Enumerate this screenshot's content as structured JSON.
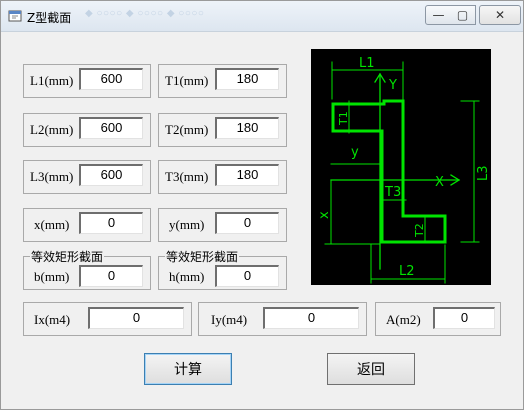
{
  "window": {
    "title": "Z型截面",
    "title_faint": "◆  ○○○○ ◆  ○○○○ ◆  ○○○○",
    "controls": {
      "minimize": "—",
      "maximize": "▢",
      "close": "✕"
    }
  },
  "inputs": {
    "L1": {
      "label": "L1(mm)",
      "value": "600"
    },
    "L2": {
      "label": "L2(mm)",
      "value": "600"
    },
    "L3": {
      "label": "L3(mm)",
      "value": "600"
    },
    "T1": {
      "label": "T1(mm)",
      "value": "180"
    },
    "T2": {
      "label": "T2(mm)",
      "value": "180"
    },
    "T3": {
      "label": "T3(mm)",
      "value": "180"
    },
    "x": {
      "label": "x(mm)",
      "value": "0"
    },
    "y": {
      "label": "y(mm)",
      "value": "0"
    }
  },
  "equivalent": {
    "left": {
      "title": "等效矩形截面",
      "label": "b(mm)",
      "value": "0"
    },
    "right": {
      "title": "等效矩形截面",
      "label": "h(mm)",
      "value": "0"
    }
  },
  "results": {
    "Ix": {
      "label": "Ix(m4)",
      "value": "0"
    },
    "Iy": {
      "label": "Iy(m4)",
      "value": "0"
    },
    "A": {
      "label": "A(m2)",
      "value": "0"
    }
  },
  "buttons": {
    "calculate": "计算",
    "back": "返回"
  },
  "diagram": {
    "labels": {
      "L1": "L1",
      "L2": "L2",
      "L3": "L3",
      "T1": "T1",
      "T2": "T2",
      "T3": "T3",
      "X": "X",
      "Y": "Y",
      "x": "x",
      "y": "y"
    }
  },
  "colors": {
    "diagram_line": "#00e400",
    "diagram_bg": "#000000",
    "window_bg": "#f0f0f0"
  }
}
